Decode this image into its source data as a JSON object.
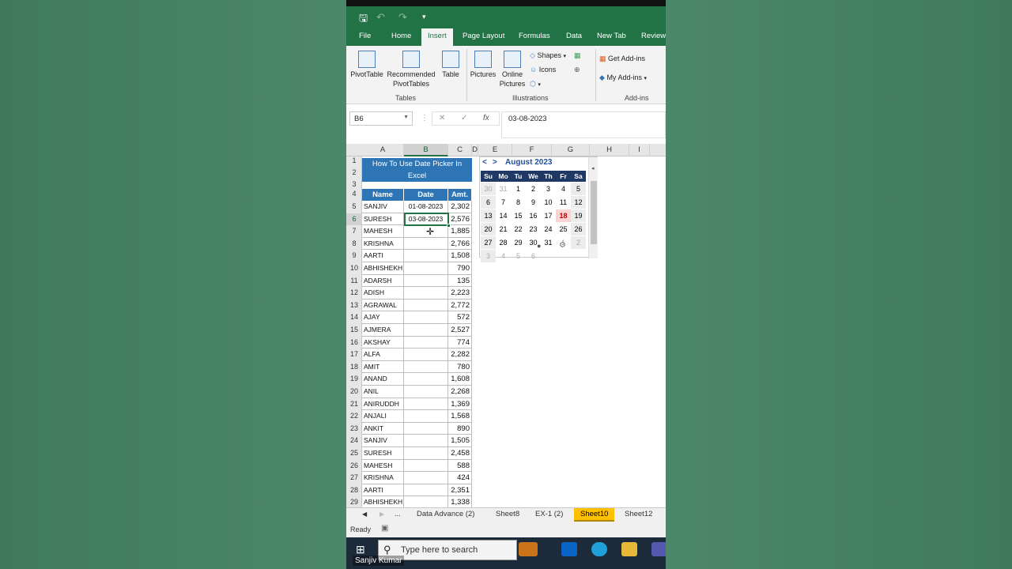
{
  "qat": {
    "save": "🖫",
    "undo": "↶",
    "redo": "↷",
    "customize": "▾"
  },
  "tabs": [
    "File",
    "Home",
    "Insert",
    "Page Layout",
    "Formulas",
    "Data",
    "New Tab",
    "Review"
  ],
  "active_tab": "Insert",
  "ribbon": {
    "pivottable": "PivotTable",
    "recommended1": "Recommended",
    "recommended2": "PivotTables",
    "table": "Table",
    "group_tables": "Tables",
    "pictures": "Pictures",
    "online1": "Online",
    "online2": "Pictures",
    "shapes": "Shapes",
    "icons": "Icons",
    "group_illustrations": "Illustrations",
    "get_addins": "Get Add-ins",
    "my_addins": "My Add-ins",
    "group_addins": "Add-ins"
  },
  "formula_bar": {
    "name_box": "B6",
    "cancel": "✕",
    "enter": "✓",
    "fx": "fx",
    "value": "03-08-2023"
  },
  "columns": [
    "A",
    "B",
    "C",
    "D",
    "E",
    "F",
    "G",
    "H",
    "I"
  ],
  "selected_column": "B",
  "selected_row": "6",
  "sheet_title": "How To Use Date Picker In Excel",
  "headers": {
    "name": "Name",
    "date": "Date",
    "amt": "Amt."
  },
  "rows": [
    {
      "n": "5",
      "name": "SANJIV",
      "date": "01-08-2023",
      "amt": "2,302"
    },
    {
      "n": "6",
      "name": "SURESH",
      "date": "03-08-2023",
      "amt": "2,576"
    },
    {
      "n": "7",
      "name": "MAHESH",
      "date": "",
      "amt": "1,885"
    },
    {
      "n": "8",
      "name": "KRISHNA",
      "date": "",
      "amt": "2,766"
    },
    {
      "n": "9",
      "name": "AARTI",
      "date": "",
      "amt": "1,508"
    },
    {
      "n": "10",
      "name": "ABHISHEKH",
      "date": "",
      "amt": "790"
    },
    {
      "n": "11",
      "name": "ADARSH",
      "date": "",
      "amt": "135"
    },
    {
      "n": "12",
      "name": "ADISH",
      "date": "",
      "amt": "2,223"
    },
    {
      "n": "13",
      "name": "AGRAWAL",
      "date": "",
      "amt": "2,772"
    },
    {
      "n": "14",
      "name": "AJAY",
      "date": "",
      "amt": "572"
    },
    {
      "n": "15",
      "name": "AJMERA",
      "date": "",
      "amt": "2,527"
    },
    {
      "n": "16",
      "name": "AKSHAY",
      "date": "",
      "amt": "774"
    },
    {
      "n": "17",
      "name": "ALFA",
      "date": "",
      "amt": "2,282"
    },
    {
      "n": "18",
      "name": "AMIT",
      "date": "",
      "amt": "780"
    },
    {
      "n": "19",
      "name": "ANAND",
      "date": "",
      "amt": "1,608"
    },
    {
      "n": "20",
      "name": "ANIL",
      "date": "",
      "amt": "2,268"
    },
    {
      "n": "21",
      "name": "ANIRUDDH",
      "date": "",
      "amt": "1,369"
    },
    {
      "n": "22",
      "name": "ANJALI",
      "date": "",
      "amt": "1,568"
    },
    {
      "n": "23",
      "name": "ANKIT",
      "date": "",
      "amt": "890"
    },
    {
      "n": "24",
      "name": "SANJIV",
      "date": "",
      "amt": "1,505"
    },
    {
      "n": "25",
      "name": "SURESH",
      "date": "",
      "amt": "2,458"
    },
    {
      "n": "26",
      "name": "MAHESH",
      "date": "",
      "amt": "588"
    },
    {
      "n": "27",
      "name": "KRISHNA",
      "date": "",
      "amt": "424"
    },
    {
      "n": "28",
      "name": "AARTI",
      "date": "",
      "amt": "2,351"
    },
    {
      "n": "29",
      "name": "ABHISHEKH",
      "date": "",
      "amt": "1,338"
    }
  ],
  "calendar": {
    "prev": "<",
    "next": ">",
    "month": "August 2023",
    "dow": [
      "Su",
      "Mo",
      "Tu",
      "We",
      "Th",
      "Fr",
      "Sa"
    ],
    "weeks": [
      [
        "30",
        "31",
        "1",
        "2",
        "3",
        "4",
        "5"
      ],
      [
        "6",
        "7",
        "8",
        "9",
        "10",
        "11",
        "12"
      ],
      [
        "13",
        "14",
        "15",
        "16",
        "17",
        "18",
        "19"
      ],
      [
        "20",
        "21",
        "22",
        "23",
        "24",
        "25",
        "26"
      ],
      [
        "27",
        "28",
        "29",
        "30",
        "31",
        "1",
        "2"
      ],
      [
        "3",
        "4",
        "5",
        "6",
        "",
        "",
        ""
      ]
    ],
    "today": "18"
  },
  "sheet_tabs": [
    "...",
    "Data Advance (2)",
    "Sheet8",
    "EX-1 (2)",
    "Sheet10",
    "Sheet12"
  ],
  "active_sheet": "Sheet10",
  "status": "Ready",
  "taskbar": {
    "search_placeholder": "Type here to search"
  },
  "credit": "Sanjiv Kumar",
  "colors": {
    "excel_green": "#217346",
    "header_blue": "#2e75b6",
    "cal_header": "#1f3864",
    "active_sheet_tab": "#ffc000"
  }
}
